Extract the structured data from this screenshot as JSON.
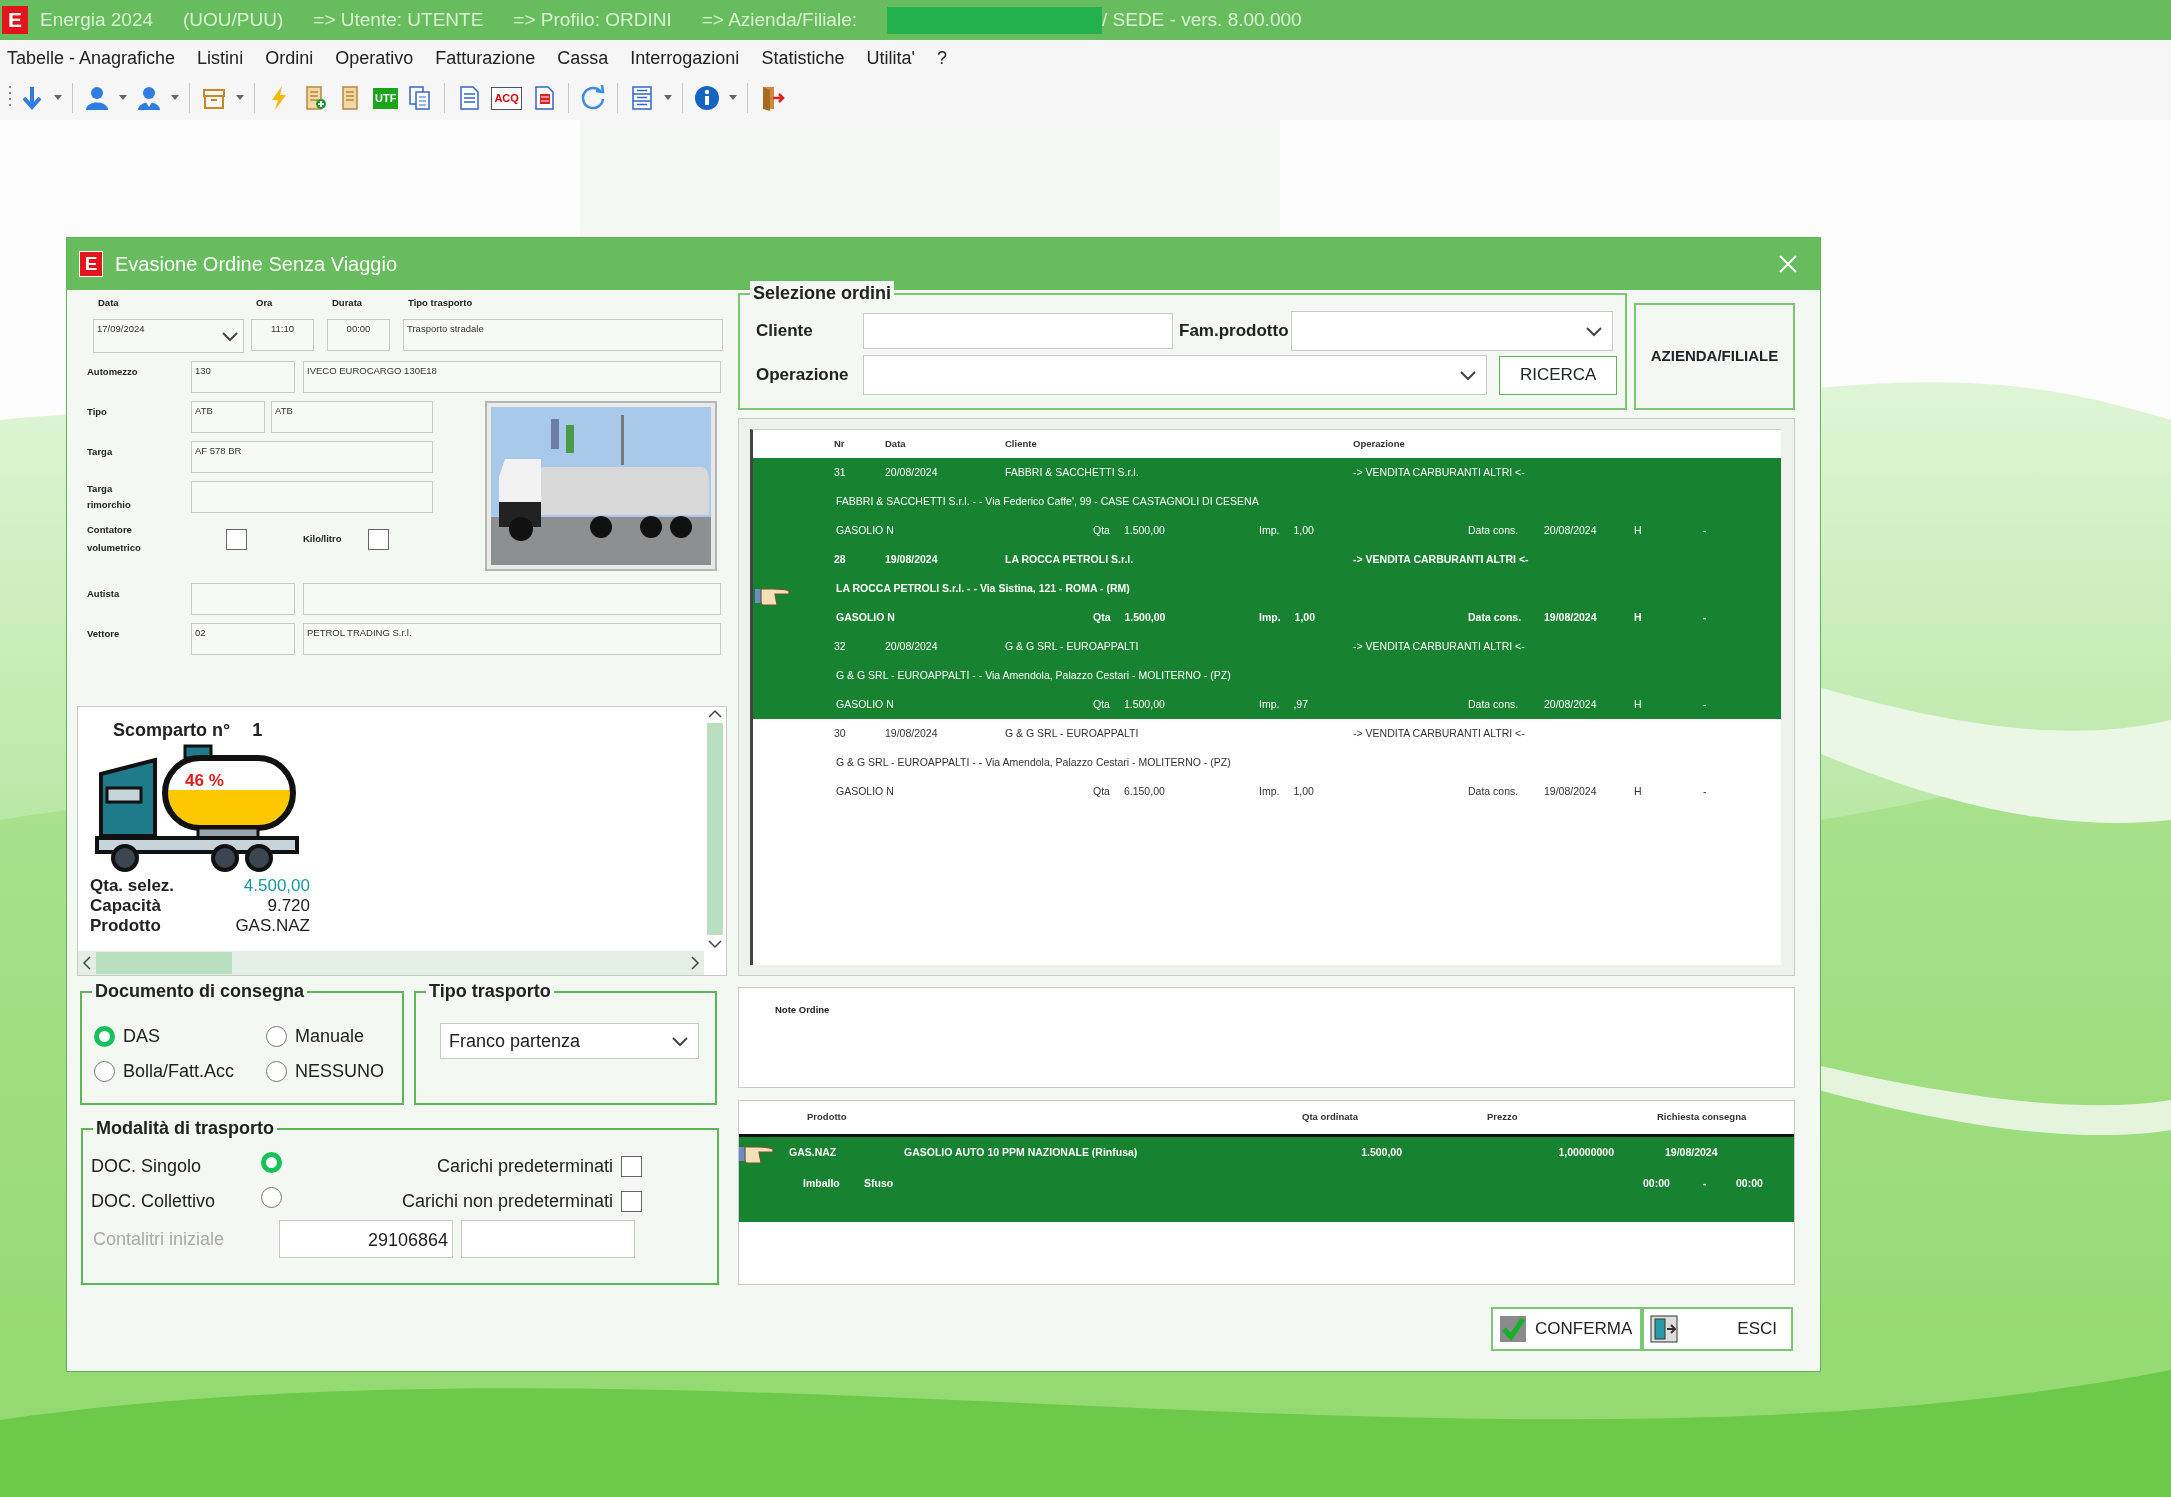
{
  "app": {
    "logo": "E",
    "title": [
      "Energia 2024",
      "(UOU/PUU)",
      "=> Utente: UTENTE",
      "=> Profilo: ORDINI",
      "=> Azienda/Filiale:"
    ],
    "redacted": true,
    "title_end": "/ SEDE - vers. 8.00.000"
  },
  "menu": [
    "Tabelle - Anagrafiche",
    "Listini",
    "Ordini",
    "Operativo",
    "Fatturazione",
    "Cassa",
    "Interrogazioni",
    "Statistiche",
    "Utilita'",
    "?"
  ],
  "toolbar": [
    [
      {
        "kind": "arrow-down",
        "dropdown": true
      }
    ],
    [
      {
        "kind": "user",
        "dropdown": true
      },
      {
        "kind": "user-alt",
        "dropdown": true
      }
    ],
    [
      {
        "kind": "archive",
        "dropdown": true
      }
    ],
    [
      {
        "kind": "lightning",
        "dropdown": false
      },
      {
        "kind": "doc-plus",
        "dropdown": false
      },
      {
        "kind": "doc",
        "dropdown": false
      },
      {
        "kind": "badge",
        "label": "UTF",
        "dropdown": false
      },
      {
        "kind": "copy",
        "dropdown": false
      }
    ],
    [
      {
        "kind": "doc-lines",
        "dropdown": false
      },
      {
        "kind": "badge-doc",
        "label": "ACQ",
        "dropdown": false
      },
      {
        "kind": "doc-red",
        "dropdown": false
      }
    ],
    [
      {
        "kind": "refresh",
        "dropdown": false
      }
    ],
    [
      {
        "kind": "list",
        "dropdown": true
      }
    ],
    [
      {
        "kind": "info",
        "dropdown": true
      }
    ],
    [
      {
        "kind": "exit",
        "dropdown": false
      }
    ]
  ],
  "dialog": {
    "logo": "E",
    "title": "Evasione Ordine Senza Viaggio",
    "form": {
      "header_labels": [
        "Data",
        "Ora",
        "Durata",
        "Tipo trasporto"
      ],
      "data": "17/09/2024",
      "ora": "11:10",
      "durata": "00:00",
      "tipo_trasporto": "Trasporto stradale",
      "automezzo": {
        "label": "Automezzo",
        "code": "130",
        "description": "IVECO EUROCARGO 130E18"
      },
      "tipo": {
        "label": "Tipo",
        "code": "ATB",
        "description": "ATB"
      },
      "targa": {
        "label": "Targa",
        "value": "AF 578 BR"
      },
      "targa_rimorchio": {
        "label": "Targa rimorchio"
      },
      "contatore": {
        "label": "Contatore volumetrico",
        "checked": false
      },
      "kilo_litro": {
        "label": "Kilo/litro",
        "checked": false
      },
      "autista": {
        "label": "Autista"
      },
      "vettore": {
        "label": "Vettore",
        "code": "02",
        "description": "PETROL TRADING S.r.l."
      },
      "photo": {
        "kind": "picture"
      }
    },
    "scomparto": {
      "title": "Scomparto n°",
      "number": "1",
      "percent": "46 %",
      "rows": [
        {
          "kind": "highlight",
          "label": "Qta. selez.",
          "value": "4.500,00"
        },
        {
          "kind": "plain",
          "label": "Capacità",
          "value": "9.720"
        },
        {
          "kind": "plain",
          "label": "Prodotto",
          "value": "GAS.NAZ"
        }
      ]
    },
    "documento": {
      "title": "Documento di consegna",
      "options": [
        {
          "label": "DAS",
          "selected": true
        },
        {
          "label": "Manuale",
          "selected": false
        },
        {
          "label": "Bolla/Fatt.Acc",
          "selected": false
        },
        {
          "label": "NESSUNO",
          "selected": false
        }
      ]
    },
    "tipo_box": {
      "title": "Tipo trasporto",
      "value": "Franco partenza"
    },
    "modalita": {
      "title": "Modalità di trasporto",
      "options": [
        {
          "label": "DOC. Singolo",
          "selected": true,
          "check_label": "Carichi predeterminati",
          "checked": false
        },
        {
          "label": "DOC. Collettivo",
          "selected": false,
          "check_label": "Carichi non predeterminati",
          "checked": false
        }
      ],
      "contalitri": {
        "label": "Contalitri iniziale",
        "disabled": true,
        "value": "29106864"
      }
    },
    "selezione": {
      "title": "Selezione ordini",
      "cliente_label": "Cliente",
      "fam_label": "Fam.prodotto",
      "operazione_label": "Operazione",
      "search_button": "RICERCA"
    },
    "azienda_button": "AZIENDA/FILIALE",
    "orders": {
      "columns": [
        "Nr",
        "Data",
        "Cliente",
        "Operazione"
      ],
      "rows": [
        {
          "selected": true,
          "current": false,
          "nr": "31",
          "date": "20/08/2024",
          "cliente": "FABBRI & SACCHETTI S.r.l.",
          "operazione": "-> VENDITA CARBURANTI ALTRI <-",
          "address": "FABBRI & SACCHETTI S.r.l. -  - Via Federico Caffe', 99 - CASE CASTAGNOLI DI CESENA",
          "product": "GASOLIO N",
          "qta_label": "Qta",
          "qta": "1.500,00",
          "imp_label": "Imp.",
          "imp": "1,00",
          "cons_label": "Data cons.",
          "cons_date": "20/08/2024",
          "h": "H",
          "dash": "-"
        },
        {
          "selected": true,
          "current": true,
          "nr": "28",
          "date": "19/08/2024",
          "cliente": "LA ROCCA PETROLI S.r.l.",
          "operazione": "-> VENDITA CARBURANTI ALTRI <-",
          "address": "LA ROCCA PETROLI S.r.l. -  - Via Sistina, 121 - ROMA - (RM)",
          "product": "GASOLIO N",
          "qta_label": "Qta",
          "qta": "1.500,00",
          "imp_label": "Imp.",
          "imp": "1,00",
          "cons_label": "Data cons.",
          "cons_date": "19/08/2024",
          "h": "H",
          "dash": "-"
        },
        {
          "selected": true,
          "current": false,
          "nr": "32",
          "date": "20/08/2024",
          "cliente": "G & G  SRL - EUROAPPALTI",
          "operazione": "-> VENDITA CARBURANTI ALTRI <-",
          "address": "G & G  SRL - EUROAPPALTI -  - Via Amendola, Palazzo Cestari - MOLITERNO - (PZ)",
          "product": "GASOLIO N",
          "qta_label": "Qta",
          "qta": "1.500,00",
          "imp_label": "Imp.",
          "imp": ",97",
          "cons_label": "Data cons.",
          "cons_date": "20/08/2024",
          "h": "H",
          "dash": "-"
        },
        {
          "selected": false,
          "current": false,
          "nr": "30",
          "date": "19/08/2024",
          "cliente": "G & G  SRL - EUROAPPALTI",
          "operazione": "-> VENDITA CARBURANTI ALTRI <-",
          "address": "G & G  SRL - EUROAPPALTI -  - Via Amendola, Palazzo Cestari - MOLITERNO - (PZ)",
          "product": "GASOLIO N",
          "qta_label": "Qta",
          "qta": "6.150,00",
          "imp_label": "Imp.",
          "imp": "1,00",
          "cons_label": "Data cons.",
          "cons_date": "19/08/2024",
          "h": "H",
          "dash": "-"
        }
      ]
    },
    "note": {
      "label": "Note Ordine"
    },
    "products": {
      "columns": [
        "Prodotto",
        "Qta ordinata",
        "Prezzo",
        "Richiesta consegna"
      ],
      "rows": [
        {
          "selected": true,
          "current": true,
          "code": "GAS.NAZ",
          "description": "GASOLIO AUTO 10 PPM NAZIONALE (Rinfusa)",
          "qta": "1.500,00",
          "prezzo": "1,00000000",
          "data": "19/08/2024",
          "imballo_label": "Imballo",
          "imballo": "Sfuso",
          "time_from": "00:00",
          "dash": "-",
          "time_to": "00:00"
        }
      ]
    },
    "buttons": [
      {
        "kind": "confirm",
        "label": "CONFERMA"
      },
      {
        "kind": "exit",
        "label": "ESCI"
      }
    ]
  }
}
